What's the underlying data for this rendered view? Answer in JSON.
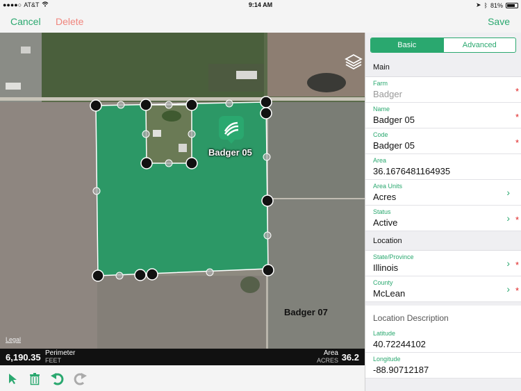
{
  "status_bar": {
    "carrier": "AT&T",
    "time": "9:14 AM",
    "battery": "81%",
    "battery_level": 0.81
  },
  "nav": {
    "cancel": "Cancel",
    "delete": "Delete",
    "save": "Save"
  },
  "map": {
    "labels": {
      "field_current": "Badger 05",
      "field_other": "Badger 07",
      "legal": "Legal"
    },
    "icons": {
      "layers": "layers-icon",
      "farm_pin": "farm-pin-icon"
    }
  },
  "measure": {
    "perimeter_value": "6,190.35",
    "perimeter_label": "Perimeter",
    "perimeter_unit": "FEET",
    "area_label": "Area",
    "area_unit": "ACRES",
    "area_value": "36.2"
  },
  "toolbar": {
    "icons": [
      "select-arrow-icon",
      "trash-icon",
      "undo-icon",
      "redo-icon"
    ]
  },
  "panel": {
    "segments": {
      "basic": "Basic",
      "advanced": "Advanced",
      "selected": "Basic"
    },
    "sections": {
      "main": "Main",
      "location": "Location"
    },
    "fields": {
      "farm": {
        "label": "Farm",
        "value": "Badger"
      },
      "name": {
        "label": "Name",
        "value": "Badger 05"
      },
      "code": {
        "label": "Code",
        "value": "Badger 05"
      },
      "area": {
        "label": "Area",
        "value": "36.1676481164935"
      },
      "area_units": {
        "label": "Area Units",
        "value": "Acres"
      },
      "status": {
        "label": "Status",
        "value": "Active"
      },
      "state": {
        "label": "State/Province",
        "value": "Illinois"
      },
      "county": {
        "label": "County",
        "value": "McLean"
      },
      "location_description": {
        "label": "Location Description"
      },
      "latitude": {
        "label": "Latitude",
        "value": "40.72244102"
      },
      "longitude": {
        "label": "Longitude",
        "value": "-88.90712187"
      }
    },
    "required_marker": "*",
    "chevron": "›"
  },
  "colors": {
    "accent": "#2aa86f",
    "delete": "#f0857d",
    "required": "#e02424",
    "field_fill": "#1f9a62"
  }
}
